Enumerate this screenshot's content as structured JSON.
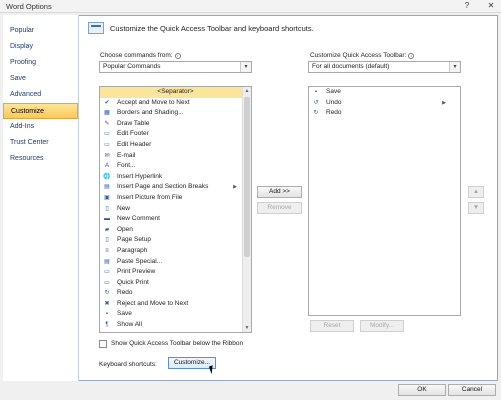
{
  "window": {
    "title": "Word Options",
    "help_glyph": "?",
    "close_glyph": "✕"
  },
  "nav": {
    "items": [
      {
        "label": "Popular"
      },
      {
        "label": "Display"
      },
      {
        "label": "Proofing"
      },
      {
        "label": "Save"
      },
      {
        "label": "Advanced"
      },
      {
        "label": "Customize",
        "active": true
      },
      {
        "label": "Add-Ins"
      },
      {
        "label": "Trust Center"
      },
      {
        "label": "Resources"
      }
    ]
  },
  "main": {
    "heading": "Customize the Quick Access Toolbar and keyboard shortcuts.",
    "choose_label": "Choose commands from:",
    "choose_value": "Popular Commands",
    "customize_label": "Customize Quick Access Toolbar:",
    "customize_value": "For all documents (default)",
    "commands": [
      {
        "label": "<Separator>",
        "separator": true,
        "icon": ""
      },
      {
        "label": "Accept and Move to Next",
        "icon": "✔"
      },
      {
        "label": "Borders and Shading...",
        "icon": "▦"
      },
      {
        "label": "Draw Table",
        "icon": "✎"
      },
      {
        "label": "Edit Footer",
        "icon": "▭"
      },
      {
        "label": "Edit Header",
        "icon": "▭"
      },
      {
        "label": "E-mail",
        "icon": "✉"
      },
      {
        "label": "Font...",
        "icon": "A"
      },
      {
        "label": "Insert Hyperlink",
        "icon": "🌐"
      },
      {
        "label": "Insert Page and Section Breaks",
        "icon": "▤",
        "submenu": "▶"
      },
      {
        "label": "Insert Picture from File",
        "icon": "▣"
      },
      {
        "label": "New",
        "icon": "▯"
      },
      {
        "label": "New Comment",
        "icon": "▬"
      },
      {
        "label": "Open",
        "icon": "▰"
      },
      {
        "label": "Page Setup",
        "icon": "▯"
      },
      {
        "label": "Paragraph",
        "icon": "≡"
      },
      {
        "label": "Paste Special...",
        "icon": "▤"
      },
      {
        "label": "Print Preview",
        "icon": "▭"
      },
      {
        "label": "Quick Print",
        "icon": "▭"
      },
      {
        "label": "Redo",
        "icon": "↻"
      },
      {
        "label": "Reject and Move to Next",
        "icon": "✖"
      },
      {
        "label": "Save",
        "icon": "▪"
      },
      {
        "label": "Show All",
        "icon": "¶"
      }
    ],
    "toolbar_items": [
      {
        "label": "Save",
        "icon": "▪"
      },
      {
        "label": "Undo",
        "icon": "↺",
        "submenu": "▶"
      },
      {
        "label": "Redo",
        "icon": "↻"
      }
    ],
    "add_button": "Add >>",
    "remove_button": "Remove",
    "reset_button": "Reset",
    "modify_button": "Modify...",
    "up_glyph": "▲",
    "down_glyph": "▼",
    "show_below_label": "Show Quick Access Toolbar below the Ribbon",
    "shortcuts_label": "Keyboard shortcuts:",
    "customize_button": "Customize...",
    "dropdown_glyph": "▾",
    "info_glyph": "i"
  },
  "footer": {
    "ok": "OK",
    "cancel": "Cancel"
  }
}
